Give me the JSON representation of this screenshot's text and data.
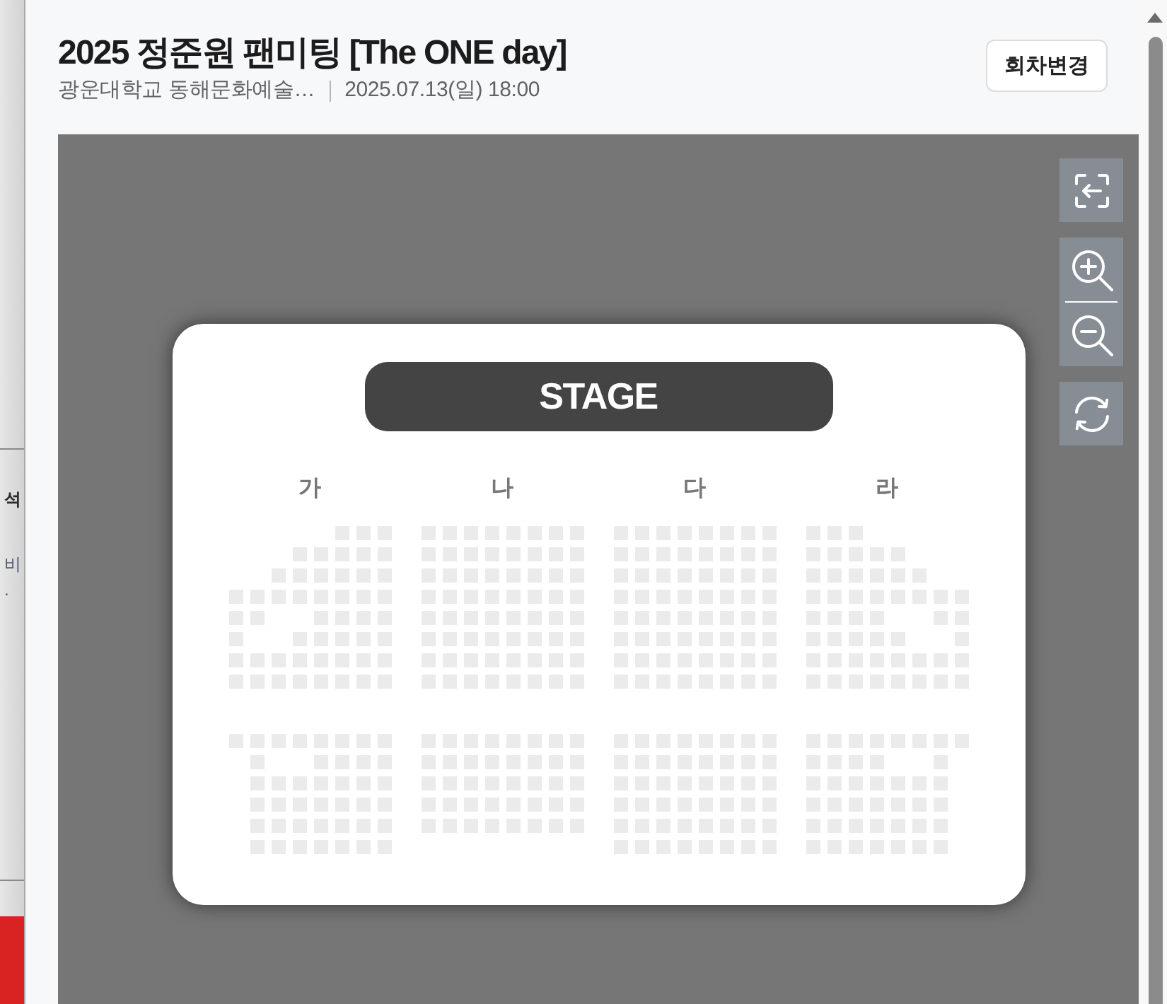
{
  "background_page": {
    "texts": [
      "석",
      "비",
      "."
    ]
  },
  "header": {
    "title": "2025 정준원 팬미팅 [The ONE day]",
    "venue": "광운대학교 동해문화예술…",
    "datetime": "2025.07.13(일) 18:00",
    "button": "회차변경"
  },
  "seat_map": {
    "stage": "STAGE",
    "sections": [
      {
        "label": "가",
        "blocks": [
          {
            "rows": [
              [
                false,
                false,
                false,
                false,
                false,
                true,
                true,
                true
              ],
              [
                false,
                false,
                false,
                true,
                true,
                true,
                true,
                true
              ],
              [
                false,
                false,
                true,
                true,
                true,
                true,
                true,
                true
              ],
              [
                true,
                true,
                true,
                true,
                true,
                true,
                true,
                true
              ],
              [
                true,
                true,
                false,
                false,
                true,
                true,
                true,
                true
              ],
              [
                true,
                false,
                false,
                true,
                true,
                true,
                true,
                true
              ],
              [
                true,
                true,
                true,
                true,
                true,
                true,
                true,
                true
              ],
              [
                true,
                true,
                true,
                true,
                true,
                true,
                true,
                true
              ]
            ]
          },
          {
            "rows": [
              [
                true,
                true,
                true,
                true,
                true,
                true,
                true,
                true
              ],
              [
                false,
                true,
                false,
                false,
                true,
                true,
                true,
                true
              ],
              [
                false,
                true,
                true,
                true,
                true,
                true,
                true,
                true
              ],
              [
                false,
                true,
                true,
                true,
                true,
                true,
                true,
                true
              ],
              [
                false,
                true,
                true,
                true,
                true,
                true,
                true,
                true
              ],
              [
                false,
                true,
                true,
                true,
                true,
                true,
                true,
                true
              ]
            ]
          }
        ]
      },
      {
        "label": "나",
        "blocks": [
          {
            "rows": [
              [
                true,
                true,
                true,
                true,
                true,
                true,
                true,
                true
              ],
              [
                true,
                true,
                true,
                true,
                true,
                true,
                true,
                true
              ],
              [
                true,
                true,
                true,
                true,
                true,
                true,
                true,
                true
              ],
              [
                true,
                true,
                true,
                true,
                true,
                true,
                true,
                true
              ],
              [
                true,
                true,
                true,
                true,
                true,
                true,
                true,
                true
              ],
              [
                true,
                true,
                true,
                true,
                true,
                true,
                true,
                true
              ],
              [
                true,
                true,
                true,
                true,
                true,
                true,
                true,
                true
              ],
              [
                true,
                true,
                true,
                true,
                true,
                true,
                true,
                true
              ]
            ]
          },
          {
            "rows": [
              [
                true,
                true,
                true,
                true,
                true,
                true,
                true,
                true
              ],
              [
                true,
                true,
                true,
                true,
                true,
                true,
                true,
                true
              ],
              [
                true,
                true,
                true,
                true,
                true,
                true,
                true,
                true
              ],
              [
                true,
                true,
                true,
                true,
                true,
                true,
                true,
                true
              ],
              [
                true,
                true,
                true,
                true,
                true,
                true,
                true,
                true
              ]
            ]
          }
        ]
      },
      {
        "label": "다",
        "blocks": [
          {
            "rows": [
              [
                true,
                true,
                true,
                true,
                true,
                true,
                true,
                true
              ],
              [
                true,
                true,
                true,
                true,
                true,
                true,
                true,
                true
              ],
              [
                true,
                true,
                true,
                true,
                true,
                true,
                true,
                true
              ],
              [
                true,
                true,
                true,
                true,
                true,
                true,
                true,
                true
              ],
              [
                true,
                true,
                true,
                true,
                true,
                true,
                true,
                true
              ],
              [
                true,
                true,
                true,
                true,
                true,
                true,
                true,
                true
              ],
              [
                true,
                true,
                true,
                true,
                true,
                true,
                true,
                true
              ],
              [
                true,
                true,
                true,
                true,
                true,
                true,
                true,
                true
              ]
            ]
          },
          {
            "rows": [
              [
                true,
                true,
                true,
                true,
                true,
                true,
                true,
                true
              ],
              [
                true,
                true,
                true,
                true,
                true,
                true,
                true,
                true
              ],
              [
                true,
                true,
                true,
                true,
                true,
                true,
                true,
                true
              ],
              [
                true,
                true,
                true,
                true,
                true,
                true,
                true,
                true
              ],
              [
                true,
                true,
                true,
                true,
                true,
                true,
                true,
                true
              ],
              [
                true,
                true,
                true,
                true,
                true,
                true,
                true,
                true
              ]
            ]
          }
        ]
      },
      {
        "label": "라",
        "blocks": [
          {
            "rows": [
              [
                true,
                true,
                true,
                false,
                false,
                false,
                false,
                false
              ],
              [
                true,
                true,
                true,
                true,
                true,
                false,
                false,
                false
              ],
              [
                true,
                true,
                true,
                true,
                true,
                true,
                false,
                false
              ],
              [
                true,
                true,
                true,
                true,
                true,
                true,
                true,
                true
              ],
              [
                true,
                true,
                true,
                true,
                false,
                false,
                true,
                true
              ],
              [
                true,
                true,
                true,
                true,
                true,
                false,
                false,
                true
              ],
              [
                true,
                true,
                true,
                true,
                true,
                true,
                true,
                true
              ],
              [
                true,
                true,
                true,
                true,
                true,
                true,
                true,
                true
              ]
            ]
          },
          {
            "rows": [
              [
                true,
                true,
                true,
                true,
                true,
                true,
                true,
                true
              ],
              [
                true,
                true,
                true,
                true,
                false,
                false,
                true,
                false
              ],
              [
                true,
                true,
                true,
                true,
                true,
                true,
                true,
                false
              ],
              [
                true,
                true,
                true,
                true,
                true,
                true,
                true,
                false
              ],
              [
                true,
                true,
                true,
                true,
                true,
                true,
                true,
                false
              ],
              [
                true,
                true,
                true,
                true,
                true,
                true,
                true,
                false
              ]
            ]
          }
        ]
      }
    ]
  }
}
